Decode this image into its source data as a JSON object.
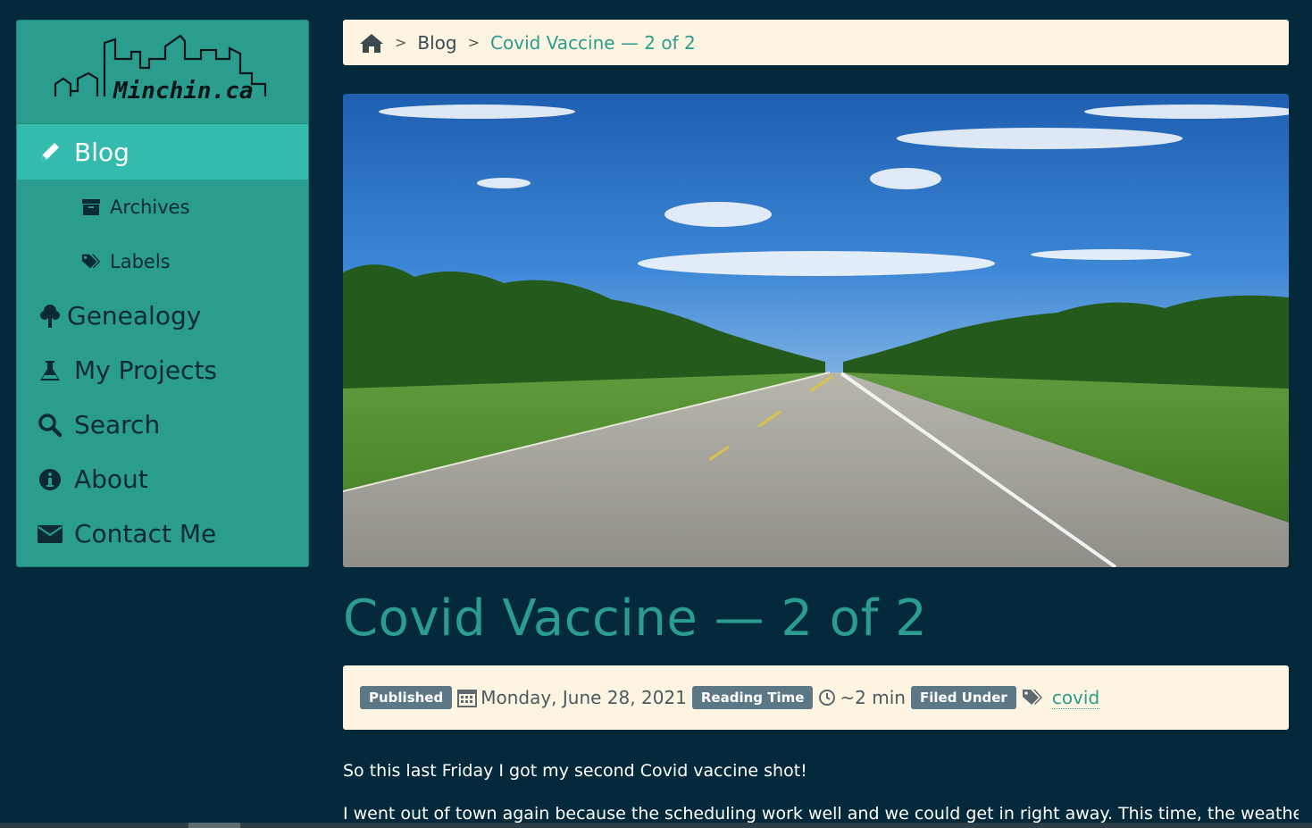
{
  "site": {
    "logo_text": "Minchin.ca"
  },
  "sidebar": {
    "items": [
      {
        "label": "Blog",
        "icon": "pencil-icon"
      },
      {
        "label": "Archives",
        "icon": "archive-icon"
      },
      {
        "label": "Labels",
        "icon": "tags-icon"
      },
      {
        "label": "Genealogy",
        "icon": "tree-icon"
      },
      {
        "label": "My Projects",
        "icon": "flask-icon"
      },
      {
        "label": "Search",
        "icon": "search-icon"
      },
      {
        "label": "About",
        "icon": "info-icon"
      },
      {
        "label": "Contact Me",
        "icon": "envelope-icon"
      }
    ],
    "active": "Blog"
  },
  "breadcrumb": {
    "home_icon": "home-icon",
    "separator": ">",
    "blog": "Blog",
    "current": "Covid Vaccine — 2 of 2"
  },
  "post": {
    "title": "Covid Vaccine — 2 of 2",
    "published_label": "Published",
    "date": "Monday, June 28, 2021",
    "reading_time_label": "Reading Time",
    "reading_time": "~2 min",
    "filed_under_label": "Filed Under",
    "tag": "covid",
    "paragraphs": [
      "So this last Friday I got my second Covid vaccine shot!",
      "I went out of town again because the scheduling work well and we could get in right away. This time, the weather"
    ]
  },
  "colors": {
    "background": "#03293a",
    "accent": "#2a9d8f",
    "active_nav": "#33bbad",
    "panel": "#fdf5e2",
    "badge": "#5c7785"
  }
}
